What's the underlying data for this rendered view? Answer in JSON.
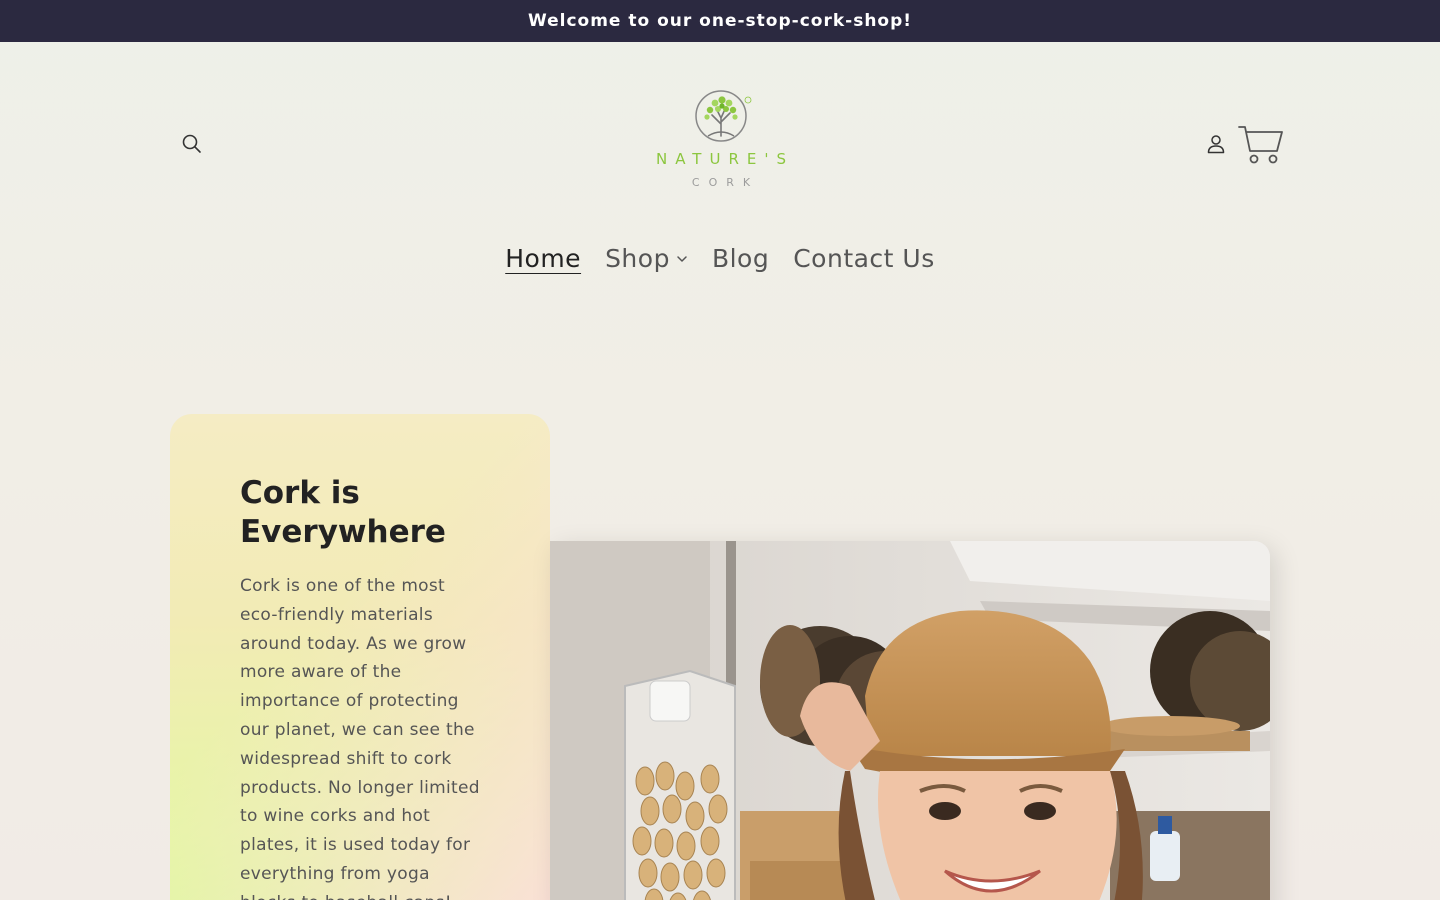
{
  "announcement": "Welcome to our one-stop-cork-shop!",
  "header": {
    "logo": {
      "word": "NATURE'S",
      "sub": "CORK"
    }
  },
  "nav": {
    "items": [
      {
        "label": "Home"
      },
      {
        "label": "Shop"
      },
      {
        "label": "Blog"
      },
      {
        "label": "Contact Us"
      }
    ]
  },
  "hero": {
    "title_line1": "Cork is",
    "title_line2": "Everywhere",
    "body": "Cork is one of the most eco-friendly materials around today. As we grow more aware of the importance of protecting our planet, we can see the widespread shift to cork products. No longer limited to wine corks and hot plates, it is used today for everything from yoga blocks to baseball caps!"
  },
  "colors": {
    "announcement_bg": "#2b2940",
    "logo_green": "#8cc63f"
  },
  "icons": [
    "search-icon",
    "account-icon",
    "cart-icon",
    "chevron-down-icon"
  ]
}
